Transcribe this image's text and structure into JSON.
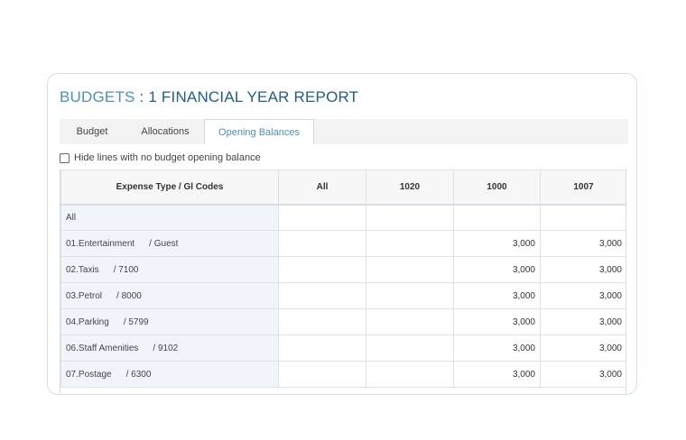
{
  "header": {
    "title_prefix": "BUDGETS",
    "title_sep": " : ",
    "title_main": "1 FINANCIAL YEAR REPORT"
  },
  "tabs": [
    {
      "label": "Budget",
      "active": false
    },
    {
      "label": "Allocations",
      "active": false
    },
    {
      "label": "Opening Balances",
      "active": true
    }
  ],
  "filter": {
    "hide_lines_label": "Hide lines with no budget opening balance",
    "checked": false
  },
  "table": {
    "columns": [
      "Expense Type / Gl Codes",
      "All",
      "1020",
      "1000",
      "1007"
    ],
    "rows": [
      {
        "type": "All",
        "gl": "",
        "all": "",
        "c1020": "",
        "c1000": "",
        "c1007": ""
      },
      {
        "type": "01.Entertainment",
        "gl": "/ Guest",
        "all": "",
        "c1020": "",
        "c1000": "3,000",
        "c1007": "3,000"
      },
      {
        "type": "02.Taxis",
        "gl": "/ 7100",
        "all": "",
        "c1020": "",
        "c1000": "3,000",
        "c1007": "3,000"
      },
      {
        "type": "03.Petrol",
        "gl": "/ 8000",
        "all": "",
        "c1020": "",
        "c1000": "3,000",
        "c1007": "3,000"
      },
      {
        "type": "04.Parking",
        "gl": "/ 5799",
        "all": "",
        "c1020": "",
        "c1000": "3,000",
        "c1007": "3,000"
      },
      {
        "type": "06.Staff Amenities",
        "gl": "/ 9102",
        "all": "",
        "c1020": "",
        "c1000": "3,000",
        "c1007": "3,000"
      },
      {
        "type": "07.Postage",
        "gl": "/ 6300",
        "all": "",
        "c1020": "",
        "c1000": "3,000",
        "c1007": "3,000"
      }
    ]
  }
}
